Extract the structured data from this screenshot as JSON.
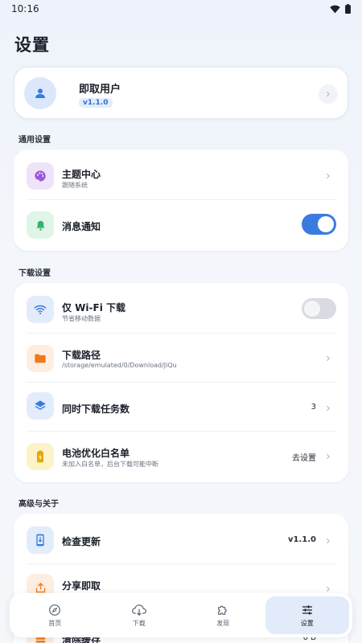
{
  "status_bar": {
    "time": "10:16"
  },
  "page": {
    "title": "设置"
  },
  "profile": {
    "name": "即取用户",
    "version": "v1.1.0"
  },
  "sections": {
    "general": "通用设置",
    "download": "下载设置",
    "advanced": "高级与关于"
  },
  "general_items": {
    "theme": {
      "title": "主题中心",
      "subtitle": "跟随系统"
    },
    "notify": {
      "title": "消息通知",
      "toggle": "on"
    }
  },
  "download_items": {
    "wifi": {
      "title": "仅 Wi-Fi 下载",
      "subtitle": "节省移动数据",
      "toggle": "off"
    },
    "path": {
      "title": "下载路径",
      "subtitle": "/storage/emulated/0/Download/JiQu"
    },
    "concurrent": {
      "title": "同时下载任务数",
      "value": "3"
    },
    "battery": {
      "title": "电池优化白名单",
      "subtitle": "未加入白名单，后台下载可能中断",
      "value": "去设置"
    }
  },
  "advanced_items": {
    "update": {
      "title": "检查更新",
      "value": "v1.1.0"
    },
    "share": {
      "title": "分享即取"
    },
    "cache": {
      "title": "清除缓存",
      "value": "0 B"
    }
  },
  "bottom_nav": [
    {
      "label": "首页",
      "icon": "compass-icon"
    },
    {
      "label": "下载",
      "icon": "cloud-download-icon"
    },
    {
      "label": "发现",
      "icon": "puzzle-icon"
    },
    {
      "label": "设置",
      "icon": "sliders-icon",
      "active": true
    }
  ],
  "colors": {
    "accent": "#3a7be0",
    "theme_icon": "#9b59d6",
    "notify_icon": "#2fb36b",
    "wifi_icon": "#3a7be0",
    "folder_icon": "#f07a1a",
    "layers_icon": "#3a7be0",
    "battery_icon": "#e0a800",
    "update_icon": "#3a7be0",
    "share_icon": "#f07a1a",
    "cache_icon": "#f07a1a"
  }
}
